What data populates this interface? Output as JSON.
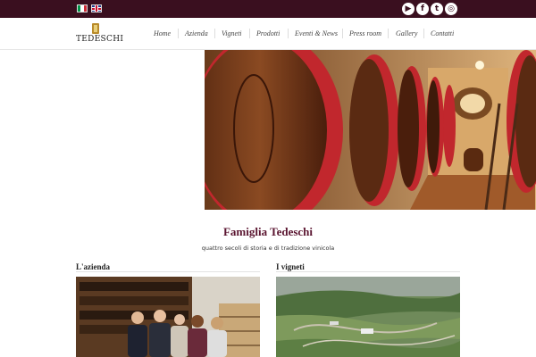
{
  "topbar": {
    "languages": [
      {
        "code": "it",
        "colors": [
          "#009246",
          "#ffffff",
          "#ce2b37"
        ]
      },
      {
        "code": "en",
        "colors": [
          "#1f3a8a",
          "#ffffff",
          "#c8102e"
        ]
      }
    ],
    "social": [
      {
        "name": "youtube-icon",
        "glyph": "▶"
      },
      {
        "name": "facebook-icon",
        "glyph": "f"
      },
      {
        "name": "twitter-icon",
        "glyph": "t"
      },
      {
        "name": "instagram-icon",
        "glyph": "◎"
      }
    ]
  },
  "header": {
    "logo_text": "TEDESCHI",
    "nav": [
      "Home",
      "Azienda",
      "Vigneti",
      "Prodotti",
      "Eventi & News",
      "Press room",
      "Gallery",
      "Contatti"
    ]
  },
  "hero": {
    "subject": "wine barrels in cellar"
  },
  "intro": {
    "title": "Famiglia Tedeschi",
    "subtitle": "quattro secoli di storia e di tradizione vinicola"
  },
  "sections": [
    {
      "title": "L'azienda"
    },
    {
      "title": "I vigneti"
    }
  ],
  "colors": {
    "brand": "#3a0f1f",
    "accent": "#5a1530",
    "barrel_red": "#c1272d"
  }
}
